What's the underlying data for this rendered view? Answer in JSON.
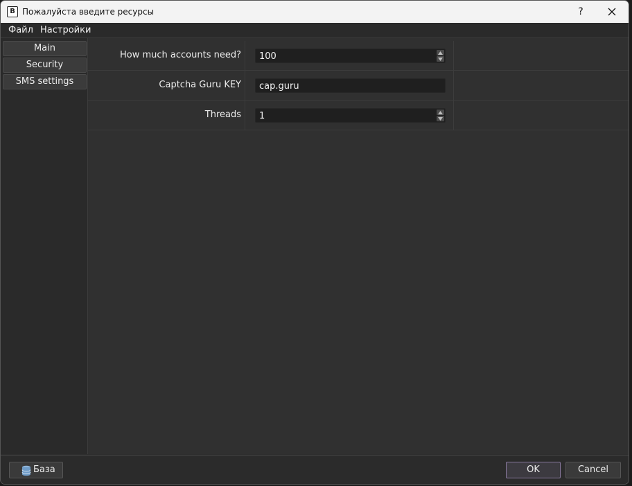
{
  "window": {
    "title": "Пожалуйста введите ресурсы",
    "help_label": "?"
  },
  "icons": {
    "app": "app-icon",
    "close": "close-icon",
    "database": "database-icon",
    "spin_up": "arrow-up-icon",
    "spin_down": "arrow-down-icon"
  },
  "menu": {
    "items": [
      {
        "label": "Файл"
      },
      {
        "label": "Настройки"
      }
    ]
  },
  "sidebar": {
    "items": [
      {
        "label": "Main"
      },
      {
        "label": "Security"
      },
      {
        "label": "SMS settings"
      }
    ]
  },
  "form": {
    "rows": [
      {
        "label": "How much accounts need?",
        "value": "100",
        "type": "spinbox"
      },
      {
        "label": "Captcha Guru KEY",
        "value": "cap.guru",
        "type": "text"
      },
      {
        "label": "Threads",
        "value": "1",
        "type": "spinbox"
      }
    ]
  },
  "footer": {
    "db_label": "База",
    "ok_label": "OK",
    "cancel_label": "Cancel"
  },
  "colors": {
    "background": "#2d2d2d",
    "field": "#1f1f1f",
    "ok_border": "#8a7aa0",
    "titlebar": "#f3f3f3"
  }
}
